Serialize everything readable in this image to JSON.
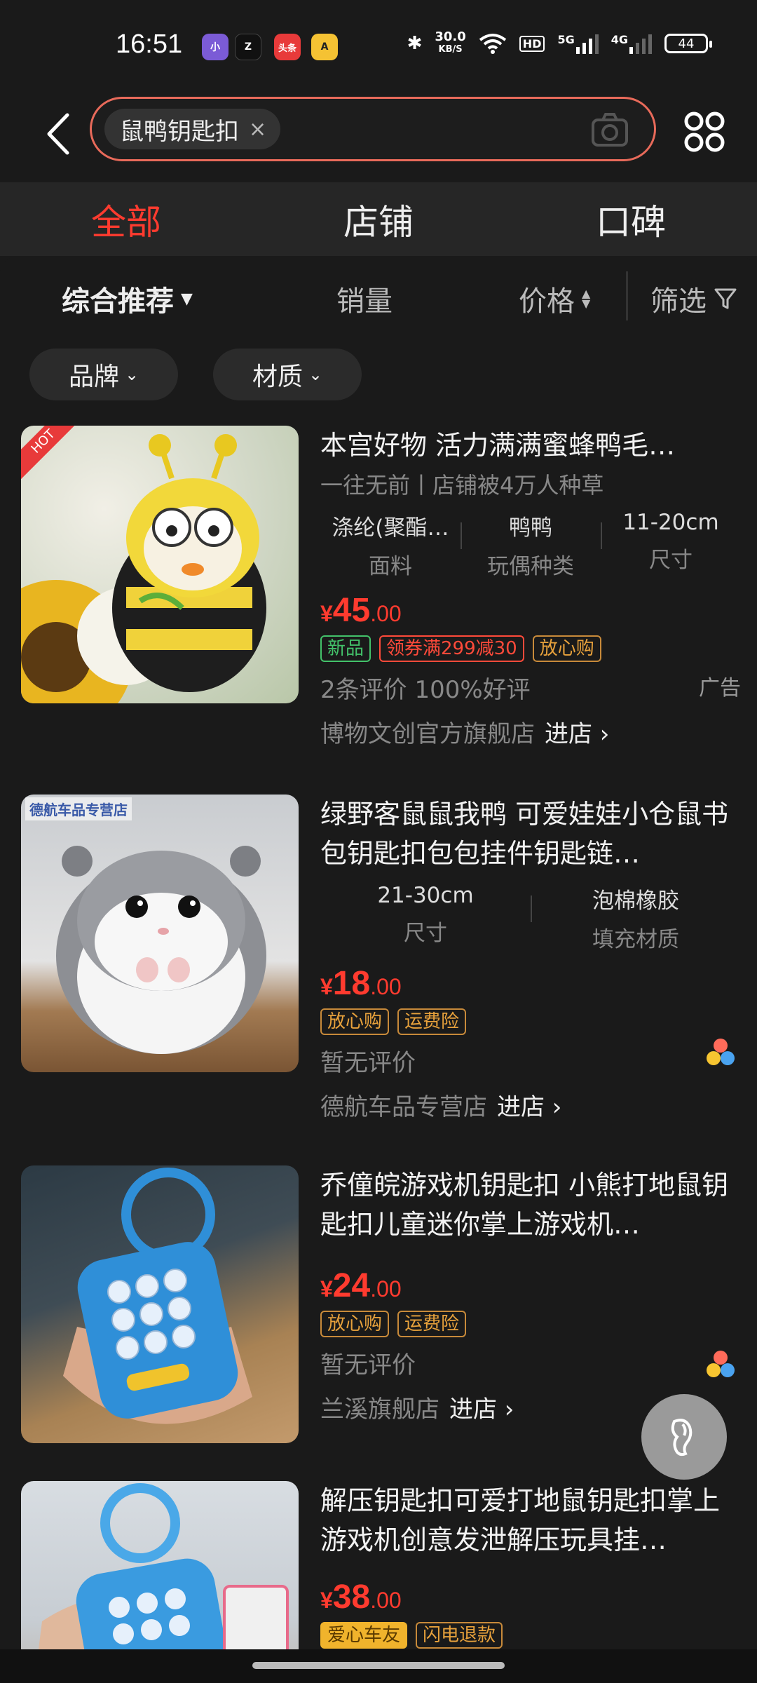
{
  "status": {
    "time": "16:51",
    "apps": [
      "小",
      "Z",
      "头条",
      "A"
    ],
    "net_speed": "30.0",
    "net_unit": "KB/S",
    "hd": "HD",
    "sig1": "5G",
    "sig2": "4G",
    "battery": "44"
  },
  "search": {
    "chip_text": "鼠鸭钥匙扣",
    "chip_close": "×"
  },
  "tabs": [
    "全部",
    "店铺",
    "口碑"
  ],
  "sort": {
    "comprehensive": "综合推荐",
    "sales": "销量",
    "price": "价格",
    "filter": "筛选"
  },
  "filters": [
    "品牌",
    "材质"
  ],
  "products": [
    {
      "title": "本宫好物 活力满满蜜蜂鸭毛…",
      "sub": "一往无前丨店铺被4万人种草",
      "attrs": [
        {
          "v": "涤纶(聚酯…",
          "k": "面料"
        },
        {
          "v": "鸭鸭",
          "k": "玩偶种类"
        },
        {
          "v": "11-20cm",
          "k": "尺寸"
        }
      ],
      "price_sym": "¥",
      "price_int": "45",
      "price_dec": ".00",
      "badges": [
        "新品",
        "领券满299减30",
        "放心购"
      ],
      "meta": "2条评价  100%好评",
      "ad": "广告",
      "store": "博物文创官方旗舰店",
      "enter": "进店 ›",
      "hot": "HOT"
    },
    {
      "title": "绿野客鼠鼠我鸭 可爱娃娃小仓鼠书包钥匙扣包包挂件钥匙链…",
      "attrs": [
        {
          "v": "21-30cm",
          "k": "尺寸"
        },
        {
          "v": "泡棉橡胶",
          "k": "填充材质"
        }
      ],
      "price_sym": "¥",
      "price_int": "18",
      "price_dec": ".00",
      "badges": [
        "放心购",
        "运费险"
      ],
      "meta": "暂无评价",
      "store": "德航车品专营店",
      "enter": "进店 ›",
      "watermark": "德航车品专营店"
    },
    {
      "title": "乔僮皖游戏机钥匙扣 小熊打地鼠钥匙扣儿童迷你掌上游戏机…",
      "price_sym": "¥",
      "price_int": "24",
      "price_dec": ".00",
      "badges": [
        "放心购",
        "运费险"
      ],
      "meta": "暂无评价",
      "store": "兰溪旗舰店",
      "enter": "进店 ›"
    },
    {
      "title": "解压钥匙扣可爱打地鼠钥匙扣掌上游戏机创意发泄解压玩具挂…",
      "price_sym": "¥",
      "price_int": "38",
      "price_dec": ".00",
      "badges": [
        "爱心车友",
        "闪电退款"
      ]
    }
  ],
  "colors": {
    "accent": "#ff3b2f",
    "background": "#1a1a1a",
    "search_border": "#e86a5a"
  }
}
